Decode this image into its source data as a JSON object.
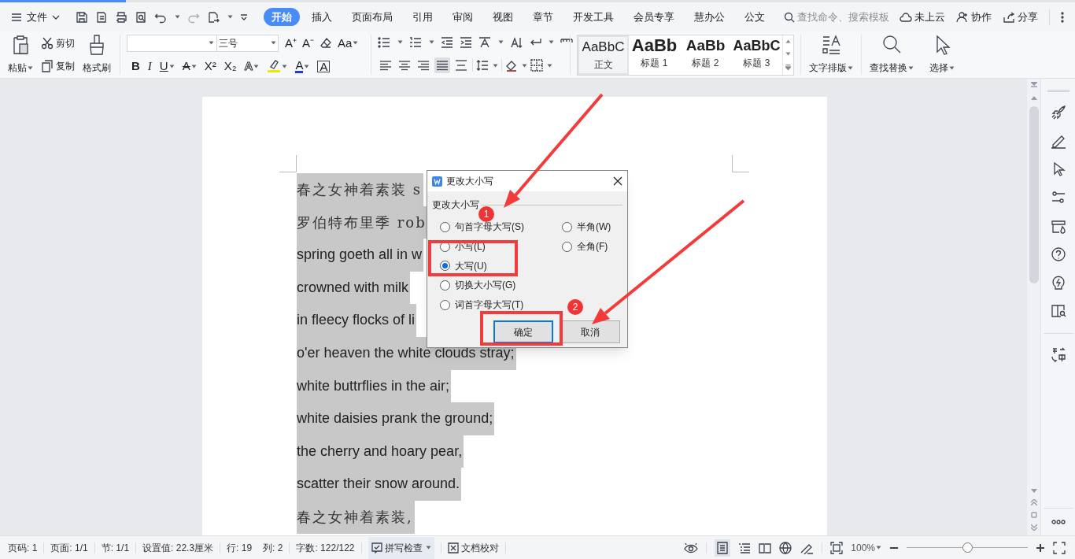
{
  "menu_bar": {
    "file_menu": "文件",
    "tabs": [
      {
        "label": "开始",
        "selected": true
      },
      {
        "label": "插入",
        "selected": false
      },
      {
        "label": "页面布局",
        "selected": false
      },
      {
        "label": "引用",
        "selected": false
      },
      {
        "label": "审阅",
        "selected": false
      },
      {
        "label": "视图",
        "selected": false
      },
      {
        "label": "章节",
        "selected": false
      },
      {
        "label": "开发工具",
        "selected": false
      },
      {
        "label": "会员专享",
        "selected": false
      },
      {
        "label": "慧办公",
        "selected": false
      },
      {
        "label": "公文",
        "selected": false
      }
    ],
    "search": {
      "placeholder": "查找命令、搜索模板"
    },
    "actions": [
      "未上云",
      "协作",
      "分享"
    ]
  },
  "ribbon": {
    "clipboard": {
      "paste": "粘贴",
      "cut": "剪切",
      "copy": "复制",
      "format_painter": "格式刷"
    },
    "font_size": "三号",
    "font_row1": [
      {
        "glyph": "A⁺",
        "kind": "plain",
        "dropdown": false
      },
      {
        "glyph": "A⁻",
        "kind": "plain",
        "dropdown": false
      },
      {
        "kind": "eraser",
        "dropdown": false
      },
      {
        "glyph": "Aa",
        "kind": "plain",
        "dropdown": true
      }
    ],
    "font_row2": [
      {
        "glyph": "B",
        "kind": "bold",
        "dropdown": false
      },
      {
        "glyph": "I",
        "kind": "italic",
        "dropdown": false
      },
      {
        "glyph": "U",
        "kind": "underline",
        "dropdown": true
      },
      {
        "glyph": "A",
        "kind": "strike",
        "dropdown": true
      },
      {
        "glyph": "X²",
        "kind": "plain",
        "dropdown": false
      },
      {
        "glyph": "X₂",
        "kind": "plain",
        "dropdown": false
      },
      {
        "glyph": "A",
        "kind": "outline",
        "dropdown": true
      },
      {
        "kind": "highlighter",
        "dropdown": true
      },
      {
        "glyph": "A",
        "kind": "color",
        "dropdown": true
      },
      {
        "glyph": "A",
        "kind": "boxed",
        "dropdown": false
      }
    ],
    "align_selected": [
      false,
      false,
      false,
      true,
      false
    ],
    "styles": [
      {
        "preview": "AaBbC",
        "label": "正文",
        "selected": true,
        "kind": "normal"
      },
      {
        "preview": "AaBb",
        "label": "标题 1",
        "selected": false,
        "kind": "h1"
      },
      {
        "preview": "AaBb",
        "label": "标题 2",
        "selected": false,
        "kind": "h2"
      },
      {
        "preview": "AaBbC",
        "label": "标题 3",
        "selected": false,
        "kind": "h3"
      }
    ],
    "big_buttons": [
      "文字排版",
      "查找替换",
      "选择"
    ]
  },
  "document": {
    "lines": [
      {
        "text": "春之女神着素装 s",
        "kind": "cjk"
      },
      {
        "text": "罗伯特布里季 rob",
        "kind": "cjk"
      },
      {
        "text": "spring goeth all in w",
        "kind": "latin"
      },
      {
        "text": "crowned with milk",
        "kind": "latin"
      },
      {
        "text": "in fleecy flocks of li",
        "kind": "latin"
      },
      {
        "text": "o'er heaven the white clouds stray;",
        "kind": "latin"
      },
      {
        "text": "white buttrflies in the air;",
        "kind": "latin"
      },
      {
        "text": "white daisies prank the ground;",
        "kind": "latin"
      },
      {
        "text": "the cherry and hoary pear,",
        "kind": "latin"
      },
      {
        "text": "scatter their snow around.",
        "kind": "latin"
      },
      {
        "text": "春之女神着素装,",
        "kind": "cjk"
      }
    ]
  },
  "dialog": {
    "title": "更改大小写",
    "group": "更改大小写",
    "options_left": [
      {
        "label": "句首字母大写(S)",
        "selected": false
      },
      {
        "label": "小写(L)",
        "selected": false
      },
      {
        "label": "大写(U)",
        "selected": true
      },
      {
        "label": "切换大小写(G)",
        "selected": false
      },
      {
        "label": "词首字母大写(T)",
        "selected": false
      }
    ],
    "options_right": [
      {
        "label": "半角(W)",
        "selected": false
      },
      {
        "label": "全角(F)",
        "selected": false
      }
    ],
    "buttons": [
      {
        "label": "确定",
        "default": true
      },
      {
        "label": "取消",
        "default": false
      }
    ]
  },
  "annotations": {
    "badges": [
      "1",
      "2"
    ]
  },
  "status_bar": {
    "items": [
      "页码: 1",
      "页面: 1/1",
      "节: 1/1",
      "设置值: 22.3厘米",
      "行: 19",
      "列: 2",
      "字数: 122/122"
    ],
    "spell_check": "拼写检查",
    "proofread": "文档校对",
    "zoom": "100%",
    "zoom_slider": {
      "level": 0.5
    }
  }
}
